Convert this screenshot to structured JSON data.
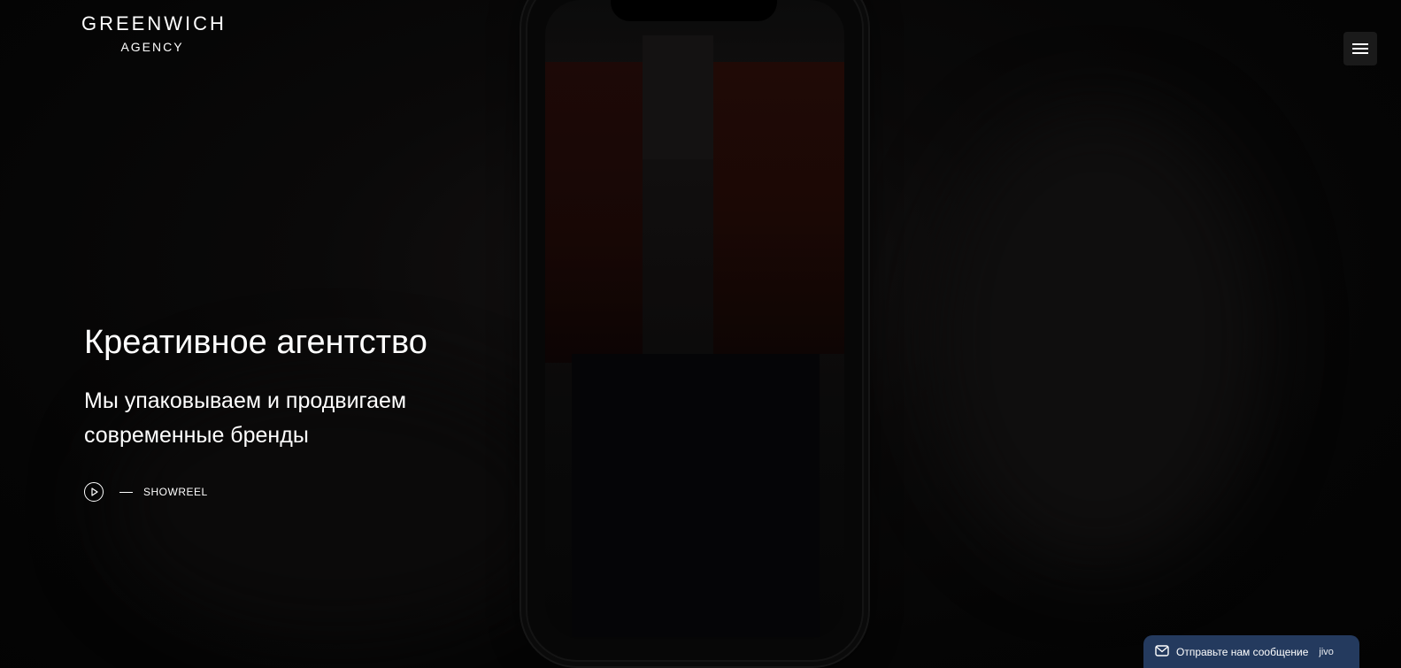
{
  "header": {
    "logo_main": "GREENWICH",
    "logo_sub": "AGENCY",
    "menu_icon": "hamburger-menu-icon"
  },
  "hero": {
    "title": "Креативное агентство",
    "subtitle": "Мы упаковываем и продвигаем современные бренды",
    "showreel_label": "SHOWREEL",
    "play_icon": "play-icon"
  },
  "chat_widget": {
    "label": "Отправьте нам сообщение",
    "brand": "jivo",
    "icon": "message-icon",
    "background": "#243a5e"
  },
  "colors": {
    "background": "#050505",
    "text": "#ffffff"
  }
}
